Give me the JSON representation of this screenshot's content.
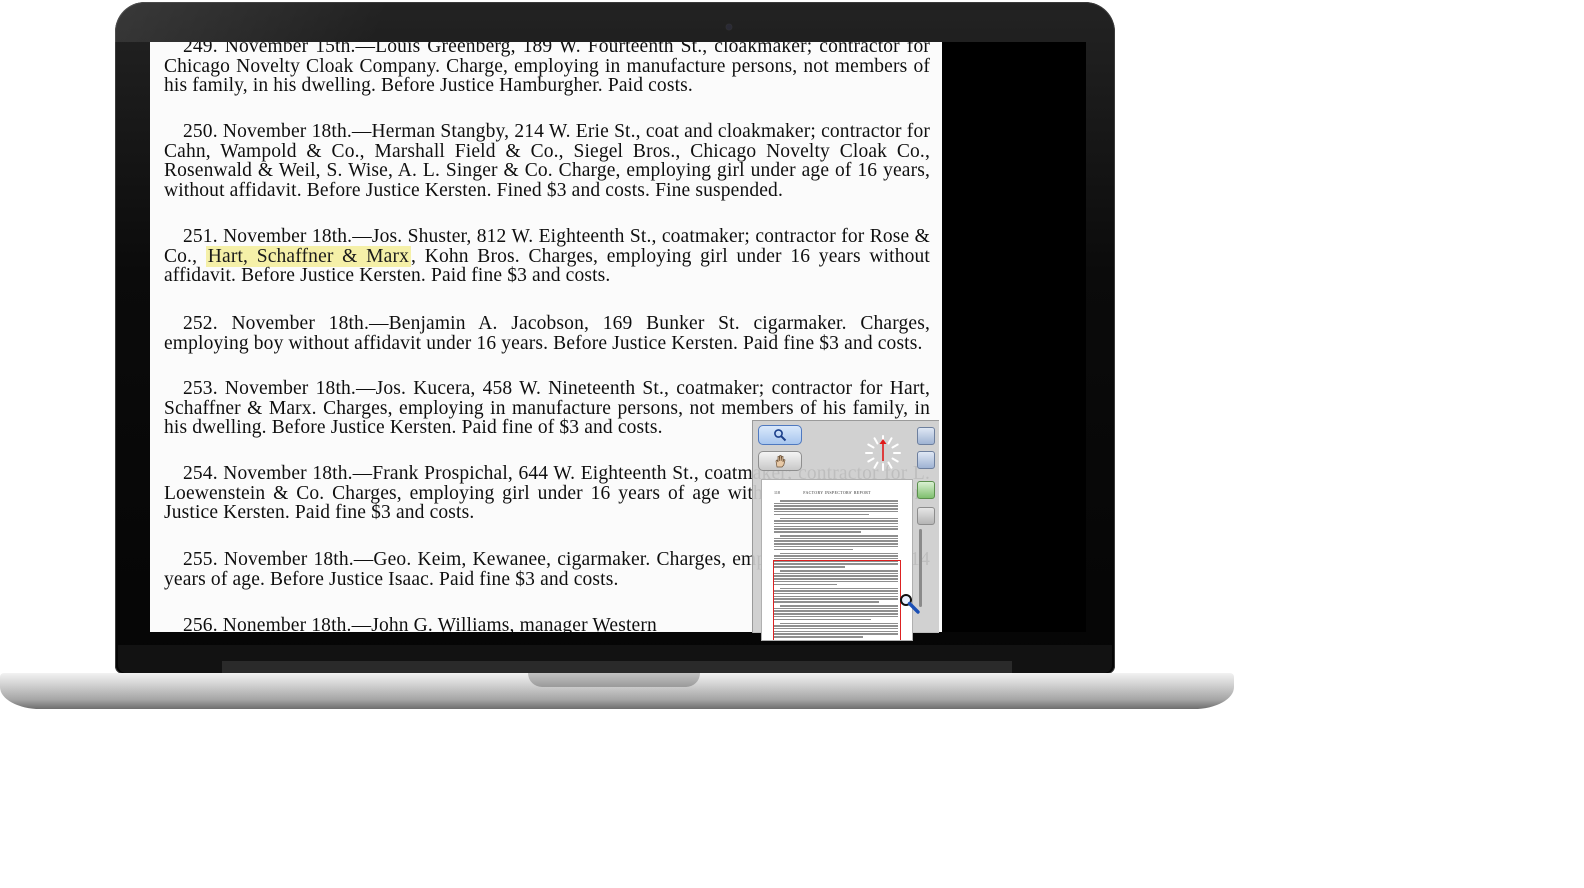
{
  "document": {
    "paragraphs": [
      {
        "id": "p249",
        "text": "249. November 15th.—Louis Greenberg, 189 W. Fourteenth St., cloakmaker; contractor for Chicago Novelty Cloak Company. Charge, employing in manufacture persons, not members of his family, in his dwelling. Before Justice Hamburgher. Paid costs."
      },
      {
        "id": "p250",
        "text": "250. November 18th.—Herman Stangby, 214 W. Erie St., coat and cloakmaker; contractor for Cahn, Wampold & Co., Marshall Field & Co., Siegel Bros., Chicago Novelty Cloak Co., Rosenwald & Weil, S. Wise, A. L. Singer & Co. Charge, employing girl under age of 16 years, without affidavit. Before Justice Kersten. Fined $3 and costs. Fine suspended."
      },
      {
        "id": "p251",
        "before": "251. November 18th.—Jos. Shuster, 812 W. Eighteenth St., coatmaker; contractor for Rose & Co., ",
        "highlight": "Hart, Schaffner & Marx",
        "after": ", Kohn Bros. Charges, employing girl under 16 years without affidavit. Before Justice Kersten. Paid fine $3 and costs."
      },
      {
        "id": "p252",
        "text": "252. November 18th.—Benjamin A. Jacobson, 169 Bunker St. cigarmaker. Charges, employing boy without affidavit under 16 years. Before Justice Kersten. Paid fine $3 and costs."
      },
      {
        "id": "p253",
        "text": "253. November 18th.—Jos. Kucera, 458 W. Nineteenth St., coatmaker; contractor for Hart, Schaffner & Marx. Charges, employing in manufacture persons, not members of his family, in his dwelling. Before Justice Kersten. Paid fine of $3 and costs."
      },
      {
        "id": "p254",
        "text": "254. November 18th.—Frank Prospichal, 644 W. Eighteenth St., coatmaker; contractor for L. Loewenstein & Co. Charges, employing girl under 16 years of age without affidavit. Before Justice Kersten. Paid fine $3 and costs."
      },
      {
        "id": "p255",
        "text": "255. November 18th.—Geo. Keim, Kewanee, cigarmaker. Charges, employing boy under 14 years of age. Before Justice Isaac. Paid fine $3 and costs."
      },
      {
        "id": "p256",
        "text": "256. Nonember 18th.—John G. Williams, manager Western"
      }
    ]
  },
  "navigator": {
    "tools": {
      "zoom_icon": "magnifier-icon",
      "pan_icon": "hand-icon"
    },
    "thumbnail": {
      "page_number": "118",
      "running_head": "FACTORY INSPECTORS' REPORT"
    }
  },
  "colors": {
    "highlight": "#f5f0a8",
    "viewport_rect": "#dd2222"
  }
}
